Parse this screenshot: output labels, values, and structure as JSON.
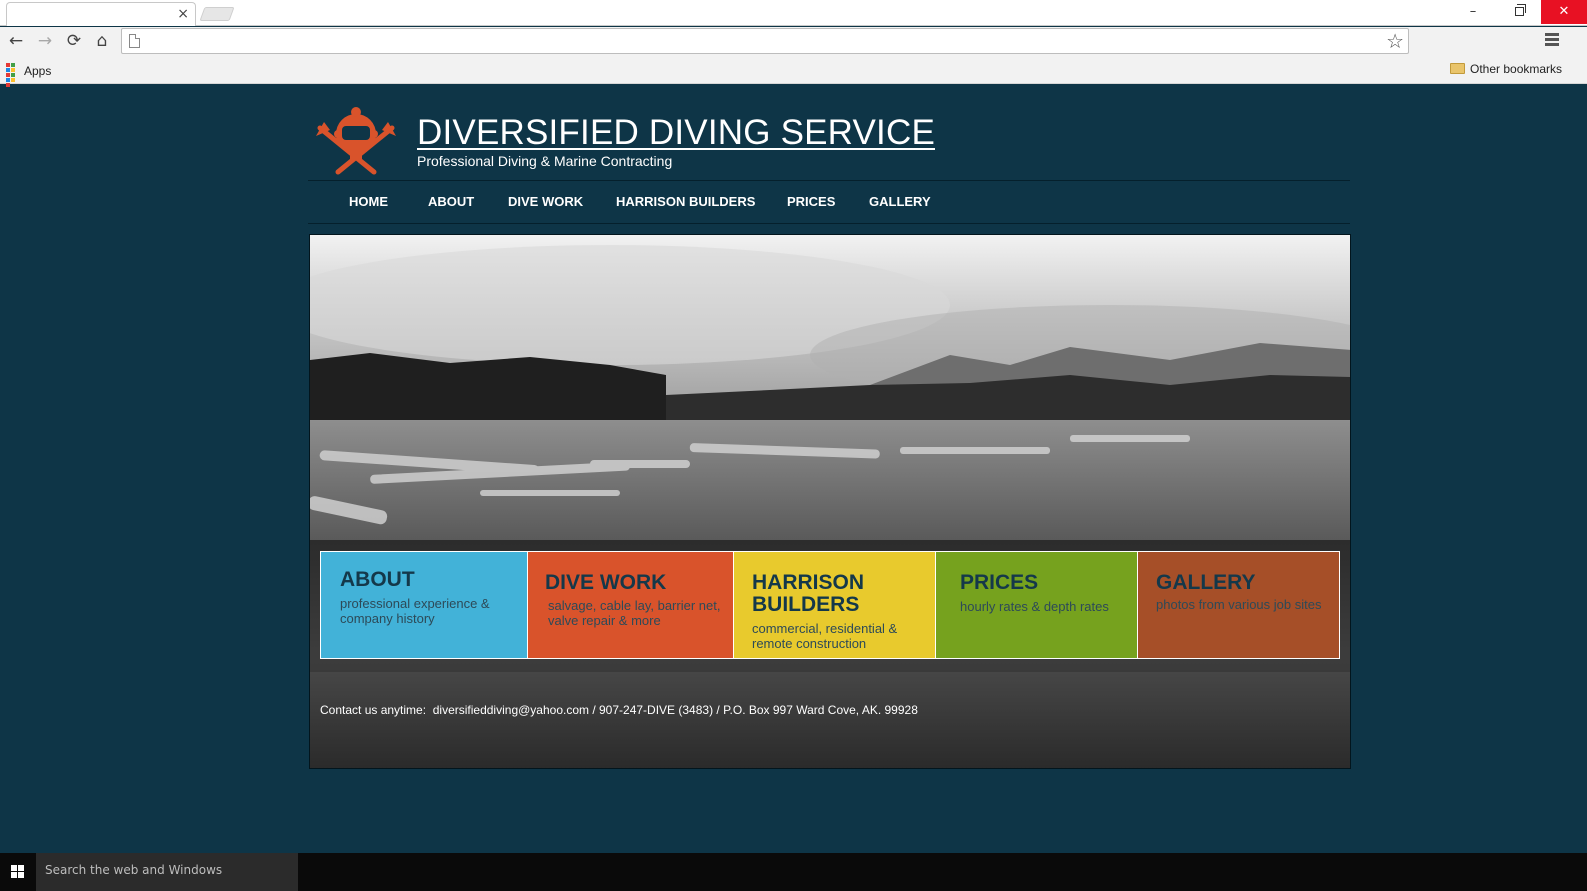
{
  "browser": {
    "tab_title": "",
    "tab_close": "×",
    "window_min": "–",
    "window_close": "✕",
    "back": "←",
    "forward": "→",
    "reload": "⟳",
    "home": "⌂",
    "address_value": "",
    "star": "☆",
    "bookmarks": {
      "apps_label": "Apps",
      "other_label": "Other bookmarks"
    }
  },
  "site": {
    "title": "DIVERSIFIED DIVING SERVICE",
    "tagline": "Professional Diving & Marine Contracting",
    "nav": [
      "HOME",
      "ABOUT",
      "DIVE WORK",
      "HARRISON BUILDERS",
      "PRICES",
      "GALLERY"
    ],
    "tiles": [
      {
        "title": "ABOUT",
        "subtitle": "professional experience & company history",
        "color": "#42b2d8"
      },
      {
        "title": "DIVE WORK",
        "subtitle": "salvage, cable lay, barrier net, valve repair & more",
        "color": "#d9532b"
      },
      {
        "title": "HARRISON BUILDERS",
        "subtitle": "commercial, residential & remote construction",
        "color": "#e8ca2d"
      },
      {
        "title": "PRICES",
        "subtitle": "hourly rates & depth rates",
        "color": "#76a21e"
      },
      {
        "title": "GALLERY",
        "subtitle": "photos from various job sites",
        "color": "#a64f28"
      }
    ],
    "contact": {
      "prefix": "Contact us anytime:",
      "email": "diversifieddiving@yahoo.com",
      "details": "/ 907-247-DIVE (3483) / P.O. Box 997 Ward Cove, AK. 99928"
    },
    "colors": {
      "page_bg": "#0e3547",
      "logo": "#d9532b"
    }
  },
  "taskbar": {
    "search_placeholder": "Search the web and Windows"
  }
}
